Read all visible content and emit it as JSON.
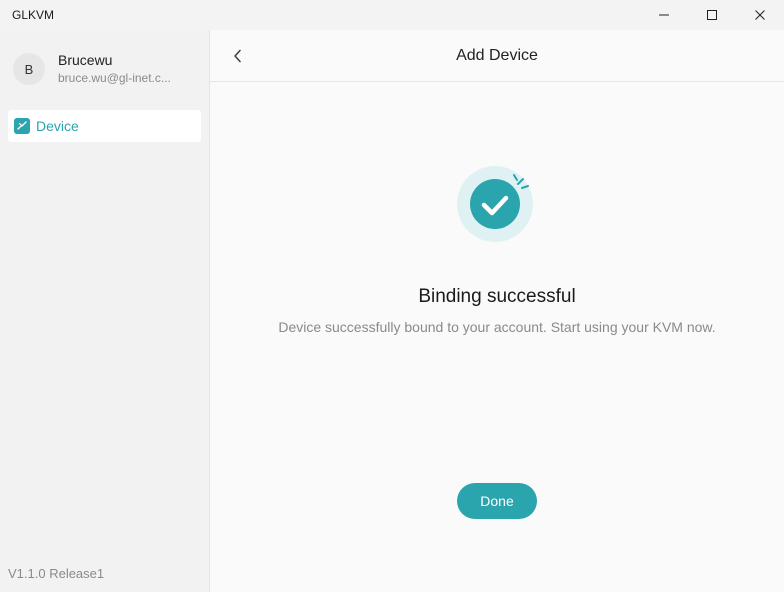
{
  "window": {
    "title": "GLKVM",
    "controls": [
      "minimize-icon",
      "maximize-icon",
      "close-icon"
    ]
  },
  "sidebar": {
    "profile": {
      "avatar_initial": "B",
      "name": "Brucewu",
      "email": "bruce.wu@gl-inet.c..."
    },
    "items": [
      {
        "label": "Device",
        "icon": "device-icon",
        "active": true
      }
    ],
    "version": "V1.1.0 Release1"
  },
  "header": {
    "back_icon": "chevron-left-icon",
    "title": "Add Device"
  },
  "result": {
    "icon": "success-check-icon",
    "title": "Binding successful",
    "description": "Device successfully bound to your account. Start using your KVM now."
  },
  "actions": {
    "done_label": "Done"
  },
  "colors": {
    "accent": "#2aa5ad",
    "accent_light": "#dff1f2",
    "sidebar_bg": "#f2f2f2",
    "main_bg": "#fafafa"
  }
}
